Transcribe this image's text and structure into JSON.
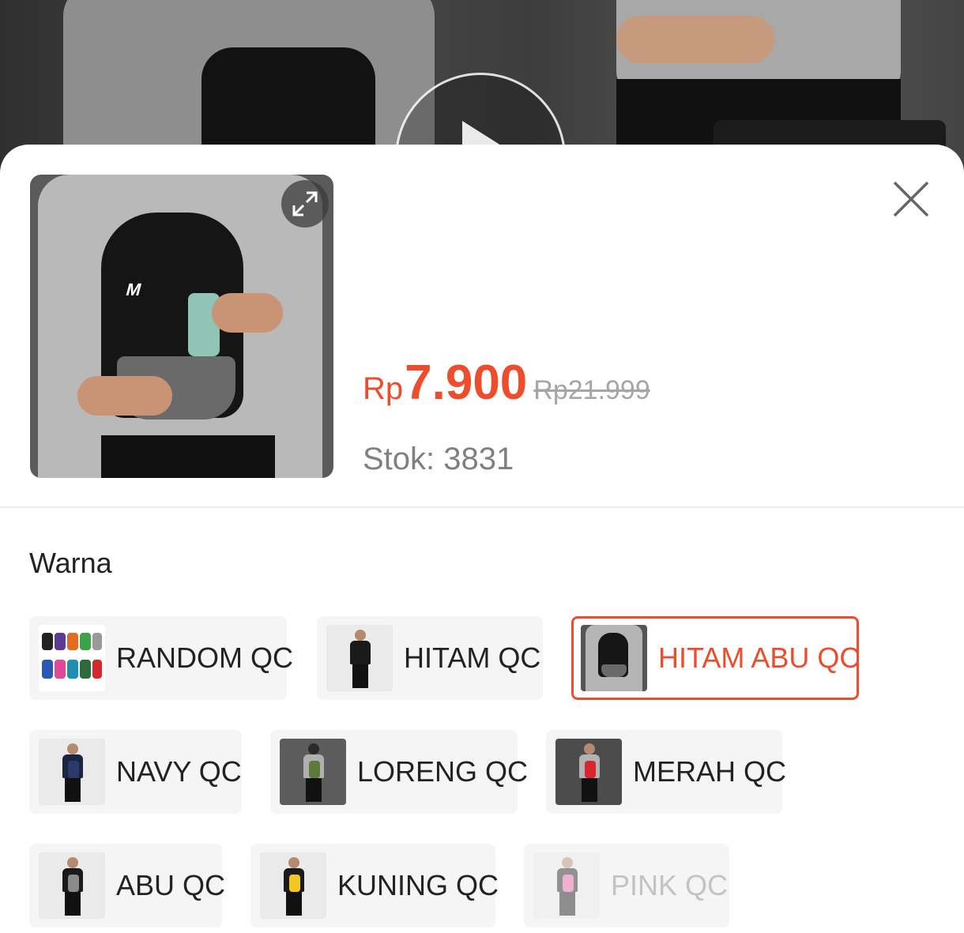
{
  "product": {
    "price_currency": "Rp",
    "price_value": "7.900",
    "original_price": "Rp21.999",
    "stock_text": "Stok: 3831"
  },
  "icons": {
    "expand": "expand-icon",
    "close": "close-icon",
    "play": "play-icon"
  },
  "variants": {
    "label": "Warna",
    "options": [
      {
        "label": "RANDOM QC",
        "state": "normal"
      },
      {
        "label": "HITAM QC",
        "state": "normal"
      },
      {
        "label": "HITAM ABU QC",
        "state": "selected"
      },
      {
        "label": "NAVY QC",
        "state": "normal"
      },
      {
        "label": "LORENG QC",
        "state": "normal"
      },
      {
        "label": "MERAH QC",
        "state": "normal"
      },
      {
        "label": "ABU QC",
        "state": "normal"
      },
      {
        "label": "KUNING QC",
        "state": "normal"
      },
      {
        "label": "PINK QC",
        "state": "disabled"
      }
    ]
  },
  "colors": {
    "accent": "#ee4d2d",
    "chip_background": "#f5f5f5",
    "disabled_text": "#c3c3c3"
  }
}
